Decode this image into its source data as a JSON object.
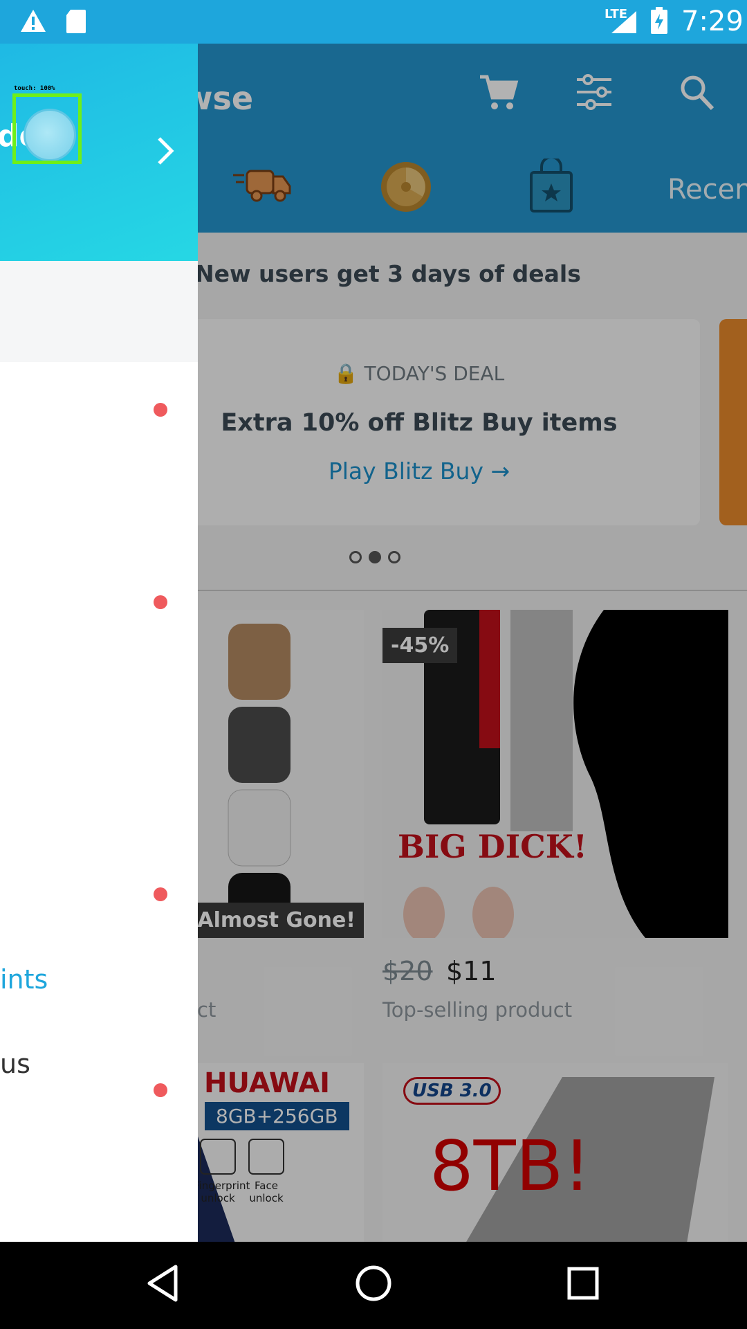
{
  "status_bar": {
    "time": "7:29",
    "network": "LTE"
  },
  "header": {
    "title_partial": "wse",
    "recent_partial": "Recen"
  },
  "promo": {
    "text": "New users get 3 days of deals"
  },
  "deal": {
    "tag": "TODAY'S DEAL",
    "title": "Extra 10% off Blitz Buy items",
    "link": "Play Blitz Buy →"
  },
  "products": [
    {
      "badge": "Almost Gone!",
      "caption": "ct"
    },
    {
      "badge": "-45%",
      "price_old": "$20",
      "price_new": "$11",
      "caption": "Top-selling product",
      "image_text": "BIG DICK!"
    },
    {
      "image_text": "HUAWAI",
      "spec": "8GB+256GB",
      "feature_1": "Fingerprint unlock",
      "feature_2": "Face unlock"
    },
    {
      "image_text": "8TB!",
      "usb": "USB 3.0"
    }
  ],
  "drawer": {
    "name_partial": "de",
    "touch_label": "touch: 100%",
    "menu_points": "ints",
    "menu_us": "us"
  },
  "colors": {
    "primary": "#1ea6dc",
    "accent": "#ef5a5d",
    "header": "#2596cf"
  }
}
